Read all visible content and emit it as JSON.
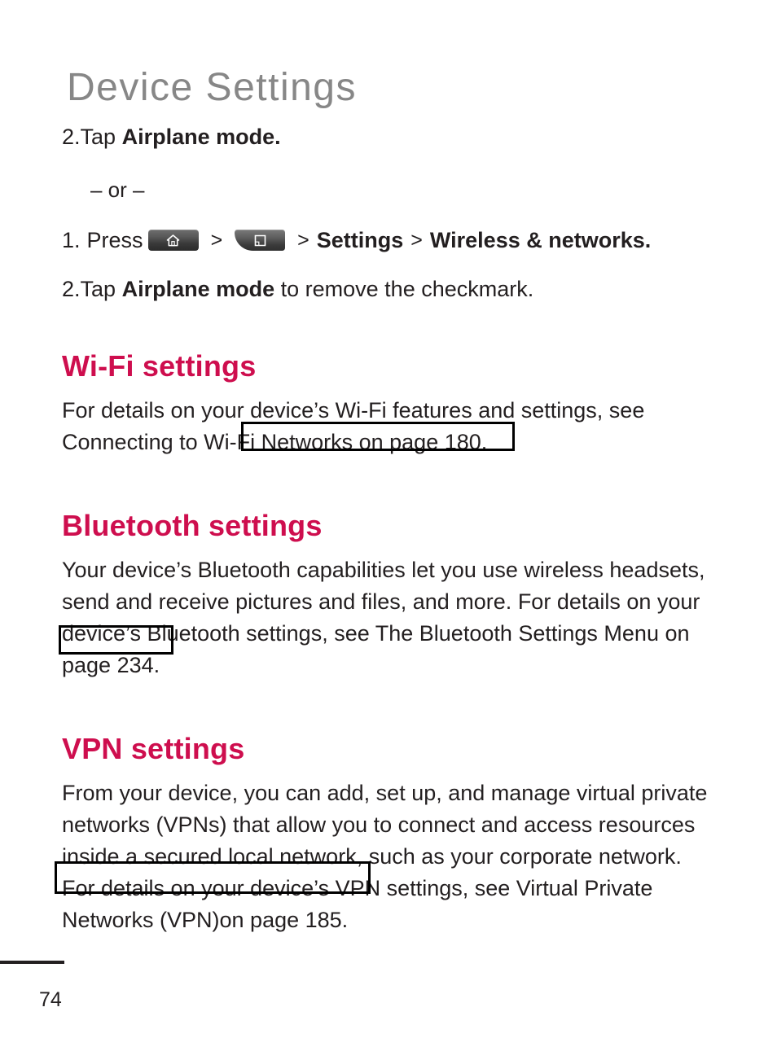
{
  "document": {
    "title": "Device Settings",
    "page_number": "74"
  },
  "steps": {
    "step_2_tap": {
      "number": "2.",
      "text_before": "Tap ",
      "bold": "Airplane mode."
    },
    "or_separator": "– or –",
    "step_1_press": {
      "number": "1.",
      "label": "Press",
      "separator_1": ">",
      "separator_2": ">",
      "settings_bold": "Settings",
      "separator_3": ">",
      "wireless_bold": "Wireless & networks.",
      "keys": [
        {
          "name": "home-key",
          "icon": "home-icon"
        },
        {
          "name": "menu-key",
          "icon": "menu-page-icon"
        }
      ]
    },
    "step_2_remove": {
      "number": "2.",
      "text_before": "Tap ",
      "bold": "Airplane mode",
      "text_after": " to remove the checkmark."
    }
  },
  "sections": [
    {
      "heading": "Wi-Fi settings",
      "lines": [
        "For details on your device’s Wi-Fi features and settings, see",
        "Connecting to Wi-Fi Networks on page 180."
      ],
      "link_text": "-Fi Networks on page 180."
    },
    {
      "heading": "Bluetooth settings",
      "lines": [
        "Your device’s Bluetooth capabilities let you use wireless headsets,",
        "send and receive pictures and files, and more. For details on your",
        "device’s Bluetooth settings, see The Bluetooth Settings Menu on",
        "page 234."
      ],
      "link_text": "page 234."
    },
    {
      "heading": "VPN settings",
      "lines": [
        "From your device, you can add, set up, and manage virtual private",
        "networks (VPNs) that allow you to connect and access resources",
        "inside a secured local network, such as your corporate network.",
        "For details on your device’s VPN settings, see Virtual Private",
        "Networks (VPN)on page 185."
      ],
      "link_text": "Networks (VPN)on page 185."
    }
  ],
  "colors": {
    "heading_red": "#ce0e4e",
    "title_gray": "#878787",
    "body_black": "#231f20"
  }
}
